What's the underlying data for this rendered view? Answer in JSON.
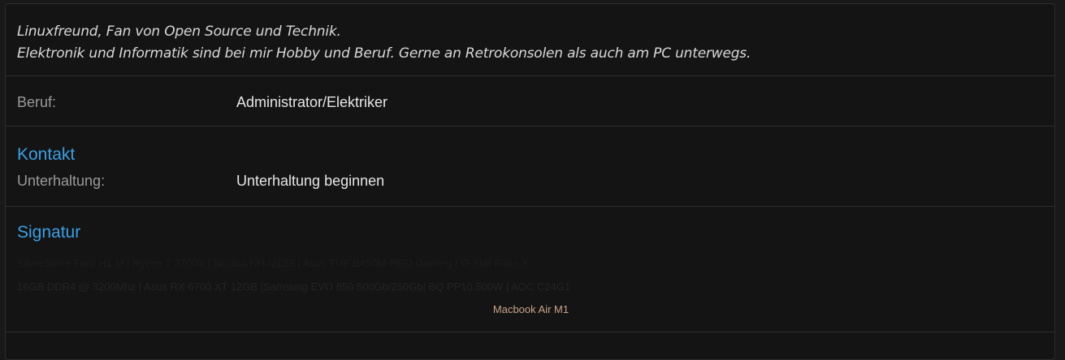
{
  "bio": {
    "line1": "Linuxfreund, Fan von Open Source und Technik.",
    "line2": "Elektronik und Informatik sind bei mir Hobby und Beruf. Gerne an Retrokonsolen als auch am PC unterwegs."
  },
  "job": {
    "label": "Beruf:",
    "value": "Administrator/Elektriker"
  },
  "contact": {
    "title": "Kontakt",
    "label": "Unterhaltung:",
    "value": "Unterhaltung beginnen"
  },
  "signature": {
    "title": "Signatur",
    "line1": "SilverStone Fara H1 M | Ryzen 7 3700X | Noctua NH-U12S | Asus TUF B450M-PRO Gaming | G.Skill Flare X",
    "line2": "16GB DDR4 @ 3200Mhz | Asus RX 6700 XT 12GB |Samsung EVO 850 500Gb/250Gb| BQ PP10 500W | AOC C24G1",
    "line3": "Macbook Air M1"
  },
  "colors": {
    "accent": "#3aa0e6",
    "background": "#141414",
    "signature_highlight": "#c9a48c"
  }
}
